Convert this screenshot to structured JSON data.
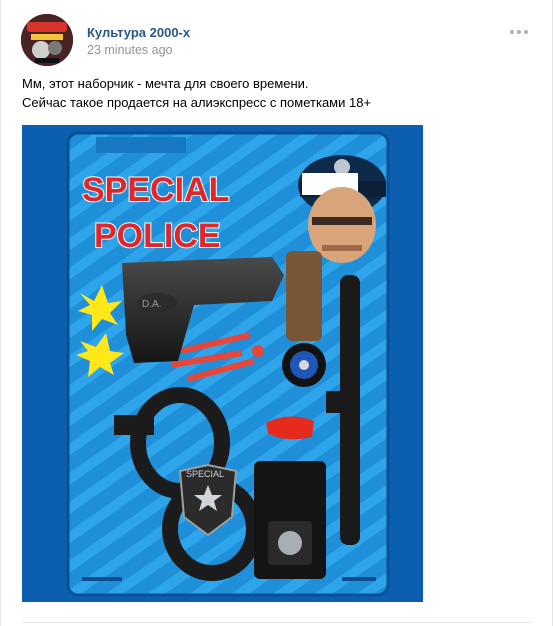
{
  "post": {
    "author": "Культура 2000-х",
    "time": "23 minutes ago",
    "text_lines": [
      "Мм, этот наборчик - мечта для своего времени.",
      "Сейчас такое продается на алиэкспресс с пометками 18+"
    ],
    "photo": {
      "package_title_line1": "SPECIAL",
      "package_title_line2": "POLICE",
      "badge_text": "SPECIAL",
      "gun_marking": "D.A."
    }
  },
  "colors": {
    "author_link": "#2a5885",
    "time_gray": "#939393",
    "card_blue": "#1e8fd8",
    "title_red": "#e0262a"
  },
  "icons": {
    "more": "three-dots-horizontal-icon"
  }
}
